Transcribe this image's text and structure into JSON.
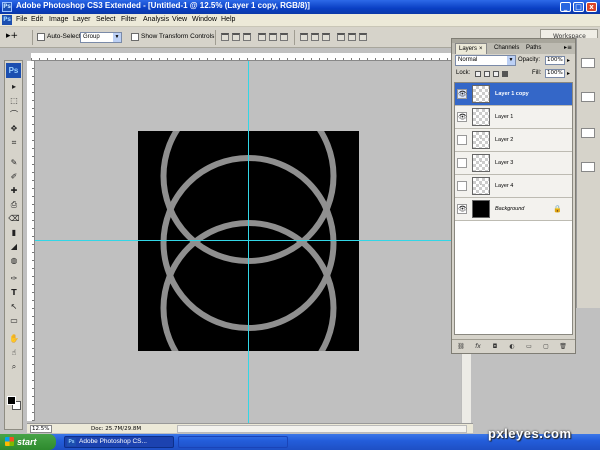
{
  "window": {
    "title": "Adobe Photoshop CS3 Extended - [Untitled-1 @ 12.5% (Layer 1 copy, RGB/8)]",
    "app_icon": "Ps",
    "min_label": "_",
    "max_label": "□",
    "close_label": "x"
  },
  "menu": {
    "items": [
      "File",
      "Edit",
      "Image",
      "Layer",
      "Select",
      "Filter",
      "Analysis",
      "View",
      "Window",
      "Help"
    ]
  },
  "options_bar": {
    "tool_preset": "▸+",
    "auto_select_label": "Auto-Select:",
    "auto_select_value": "Group",
    "show_transform_label": "Show Transform Controls",
    "workspace_label": "Workspace"
  },
  "toolbox": {
    "logo": "Ps",
    "tools": [
      "▸",
      "⬚",
      "⌒",
      "✥",
      "⌗",
      "✎",
      "✐",
      "✚",
      "⎙",
      "⌫",
      "▮",
      "◢",
      "◍",
      "✑",
      "T",
      "↖",
      "▭",
      "✋",
      "☝",
      "⌕"
    ]
  },
  "status": {
    "zoom": "12.5%",
    "doc_info": "Doc: 25.7M/29.8M"
  },
  "layers_panel": {
    "tabs": [
      "Layers",
      "Channels",
      "Paths"
    ],
    "active_tab": "Layers",
    "tab_close": "×",
    "menu_icon": "▸≡",
    "blend_mode": "Normal",
    "opacity_label": "Opacity:",
    "opacity_value": "100%",
    "lock_label": "Lock:",
    "fill_label": "Fill:",
    "fill_value": "100%",
    "layers": [
      {
        "name": "Layer 1 copy",
        "visible": true,
        "selected": true,
        "thumb": ""
      },
      {
        "name": "Layer 1",
        "visible": true,
        "selected": false,
        "thumb": ""
      },
      {
        "name": "Layer 2",
        "visible": false,
        "selected": false,
        "thumb": "·"
      },
      {
        "name": "Layer 3",
        "visible": false,
        "selected": false,
        "thumb": "·"
      },
      {
        "name": "Layer 4",
        "visible": false,
        "selected": false,
        "thumb": "·"
      },
      {
        "name": "Background",
        "visible": true,
        "selected": false,
        "thumb": ""
      }
    ],
    "eye_glyph": "👁",
    "lock_glyph": "🔒",
    "bottom_icons": [
      "⛓",
      "fx",
      "◘",
      "◐",
      "▭",
      "▢",
      "🗑"
    ]
  },
  "taskbar": {
    "start_label": "start",
    "task_label": "Adobe Photoshop CS...",
    "task_icon": "Ps"
  },
  "watermark": "pxleyes.com",
  "colors": {
    "canvas": "#000000",
    "ring_stroke": "#8f8f8f",
    "guide": "#33d6e6",
    "selected_layer": "#3467c8"
  }
}
